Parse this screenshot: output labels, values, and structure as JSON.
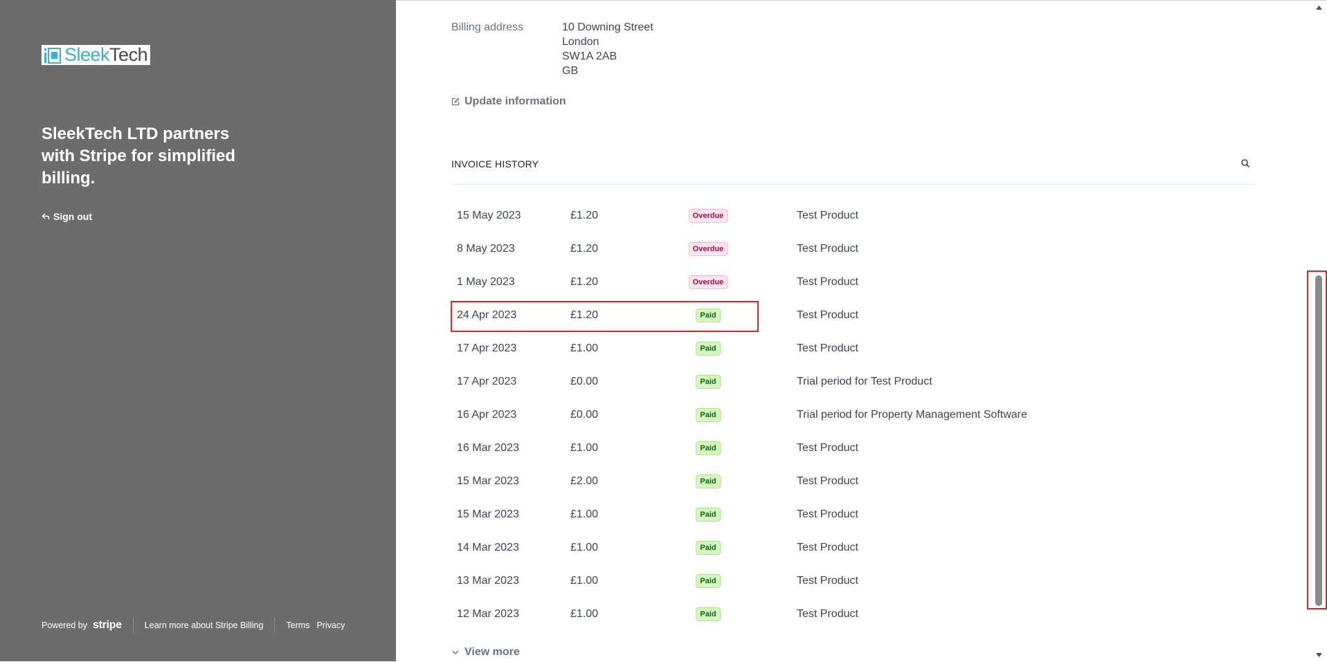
{
  "brand": {
    "logo_part1": "Sleek",
    "logo_part2": "Tech",
    "tagline": "SleekTech LTD partners with Stripe for simplified billing.",
    "sign_out": "Sign out"
  },
  "footer": {
    "powered_by": "Powered by",
    "stripe": "stripe",
    "learn_more": "Learn more about Stripe Billing",
    "terms": "Terms",
    "privacy": "Privacy"
  },
  "billing": {
    "label": "Billing address",
    "line1": "10 Downing Street",
    "line2": "London",
    "line3": "SW1A 2AB",
    "line4": "GB",
    "update_label": "Update information"
  },
  "invoice_history": {
    "title": "INVOICE HISTORY",
    "rows": [
      {
        "date": "15 May 2023",
        "amount": "£1.20",
        "status": "Overdue",
        "description": "Test Product"
      },
      {
        "date": "8 May 2023",
        "amount": "£1.20",
        "status": "Overdue",
        "description": "Test Product"
      },
      {
        "date": "1 May 2023",
        "amount": "£1.20",
        "status": "Overdue",
        "description": "Test Product"
      },
      {
        "date": "24 Apr 2023",
        "amount": "£1.20",
        "status": "Paid",
        "description": "Test Product"
      },
      {
        "date": "17 Apr 2023",
        "amount": "£1.00",
        "status": "Paid",
        "description": "Test Product"
      },
      {
        "date": "17 Apr 2023",
        "amount": "£0.00",
        "status": "Paid",
        "description": "Trial period for Test Product"
      },
      {
        "date": "16 Apr 2023",
        "amount": "£0.00",
        "status": "Paid",
        "description": "Trial period for Property Management Software"
      },
      {
        "date": "16 Mar 2023",
        "amount": "£1.00",
        "status": "Paid",
        "description": "Test Product"
      },
      {
        "date": "15 Mar 2023",
        "amount": "£2.00",
        "status": "Paid",
        "description": "Test Product"
      },
      {
        "date": "15 Mar 2023",
        "amount": "£1.00",
        "status": "Paid",
        "description": "Test Product"
      },
      {
        "date": "14 Mar 2023",
        "amount": "£1.00",
        "status": "Paid",
        "description": "Test Product"
      },
      {
        "date": "13 Mar 2023",
        "amount": "£1.00",
        "status": "Paid",
        "description": "Test Product"
      },
      {
        "date": "12 Mar 2023",
        "amount": "£1.00",
        "status": "Paid",
        "description": "Test Product"
      }
    ],
    "view_more": "View more"
  },
  "colors": {
    "sidebar_bg": "#6b6c6b",
    "overdue_text": "#b3093c",
    "paid_text": "#05690d",
    "highlight": "#e02424"
  }
}
